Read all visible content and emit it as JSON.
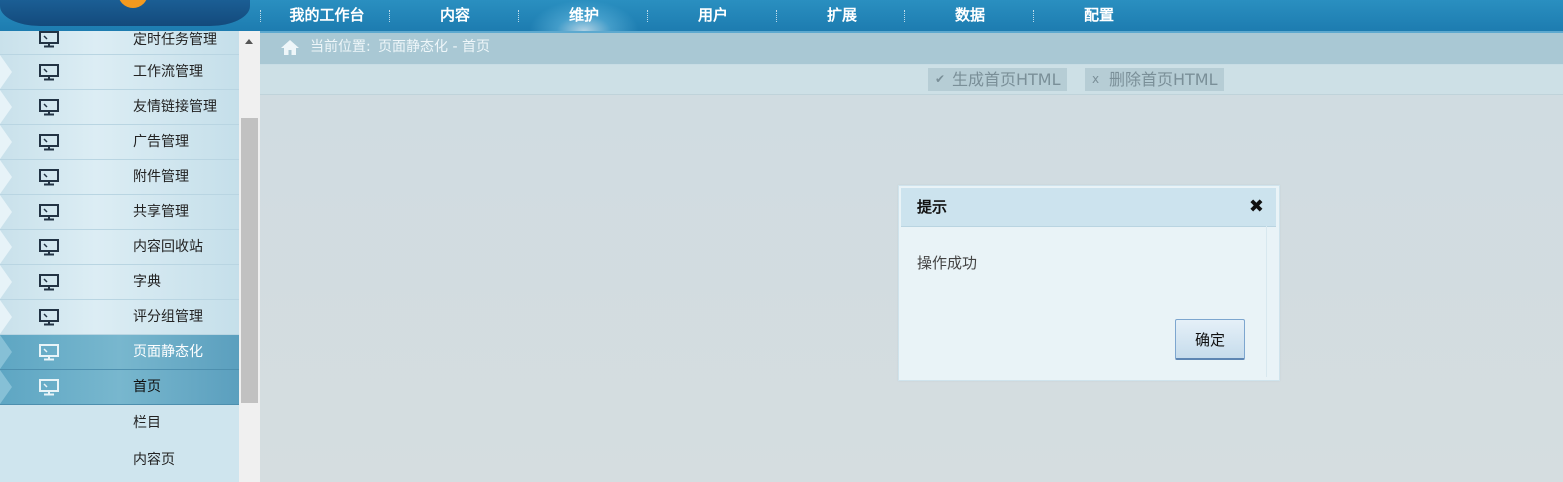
{
  "nav": {
    "items": [
      {
        "label": "我的工作台",
        "active": false
      },
      {
        "label": "内容",
        "active": false
      },
      {
        "label": "维护",
        "active": true
      },
      {
        "label": "用户",
        "active": false
      },
      {
        "label": "扩展",
        "active": false
      },
      {
        "label": "数据",
        "active": false
      },
      {
        "label": "配置",
        "active": false
      }
    ]
  },
  "sidebar": {
    "items": [
      {
        "label": "定时任务管理",
        "icon": "monitor-icon"
      },
      {
        "label": "工作流管理",
        "icon": "monitor-icon"
      },
      {
        "label": "友情链接管理",
        "icon": "monitor-icon"
      },
      {
        "label": "广告管理",
        "icon": "monitor-icon"
      },
      {
        "label": "附件管理",
        "icon": "monitor-icon"
      },
      {
        "label": "共享管理",
        "icon": "monitor-icon"
      },
      {
        "label": "内容回收站",
        "icon": "monitor-icon"
      },
      {
        "label": "字典",
        "icon": "monitor-icon"
      },
      {
        "label": "评分组管理",
        "icon": "monitor-icon"
      },
      {
        "label": "页面静态化",
        "icon": "monitor-icon",
        "active": true
      },
      {
        "label": "首页",
        "icon": "monitor-icon",
        "active": true
      }
    ],
    "subitems": [
      {
        "label": "栏目"
      },
      {
        "label": "内容页"
      }
    ]
  },
  "breadcrumb": {
    "label": "当前位置:",
    "path": "页面静态化 - 首页"
  },
  "toolbar": {
    "generate_label": "生成首页HTML",
    "delete_label": "删除首页HTML"
  },
  "dialog": {
    "title": "提示",
    "message": "操作成功",
    "ok_label": "确定",
    "close_symbol": "✖"
  },
  "colors": {
    "nav_bg": "#2a8fc0",
    "sidebar_bg": "#cfe5ee",
    "sidebar_active": "#6aafc9",
    "dialog_header": "#cce3ee"
  }
}
